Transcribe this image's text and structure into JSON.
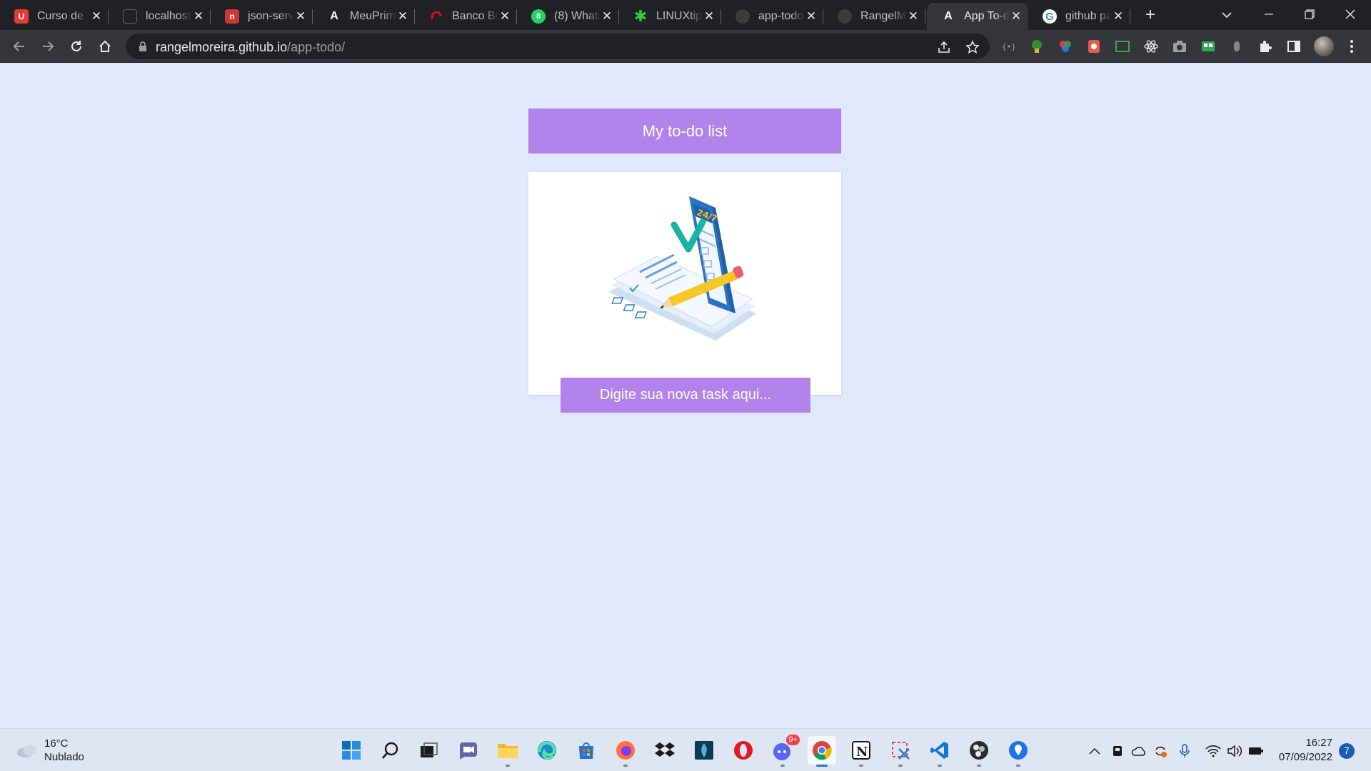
{
  "browser": {
    "tabs": [
      {
        "title": "Curso de",
        "icon": "red-logo-icon",
        "color": "#e53935"
      },
      {
        "title": "localhost",
        "icon": "terminal-icon",
        "color": "#5f6368"
      },
      {
        "title": "json-serv",
        "icon": "npm-icon",
        "color": "#cb3837"
      },
      {
        "title": "MeuPrim",
        "icon": "angular-icon",
        "color": "#ffffff"
      },
      {
        "title": "Banco Br",
        "icon": "bank-icon",
        "color": "#c8102e"
      },
      {
        "title": "(8) Whats",
        "icon": "whatsapp-icon",
        "color": "#25d366"
      },
      {
        "title": "LINUXtip",
        "icon": "linuxtips-icon",
        "color": "#2ecc40"
      },
      {
        "title": "app-todo",
        "icon": "github-icon",
        "color": "#3c3c3c"
      },
      {
        "title": "RangelM",
        "icon": "github-icon",
        "color": "#3c3c3c"
      },
      {
        "title": "App To-d",
        "icon": "angular-icon",
        "color": "#ffffff",
        "active": true
      },
      {
        "title": "github pa",
        "icon": "google-icon",
        "color": "#4285f4"
      }
    ],
    "address": {
      "host": "rangelmoreira.github.io",
      "path": "/app-todo/"
    }
  },
  "app": {
    "title": "My to-do list",
    "input_placeholder": "Digite sua nova task aqui...",
    "accent_color": "#b183ea",
    "background_color": "#e2e8fc"
  },
  "taskbar": {
    "weather": {
      "temp": "16°C",
      "condition": "Nublado"
    },
    "time": "16:27",
    "date": "07/09/2022",
    "notifications": "7",
    "discord_badge": "9+"
  }
}
